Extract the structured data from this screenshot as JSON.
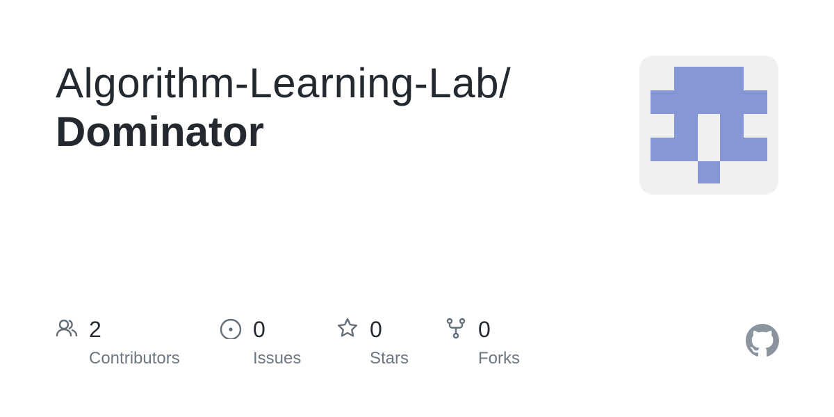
{
  "repo": {
    "owner": "Algorithm-Learning-Lab/",
    "name": "Dominator"
  },
  "avatar": {
    "background": "#f0f0f0",
    "fill": "#8796d6"
  },
  "stats": [
    {
      "icon": "people-icon",
      "count": "2",
      "label": "Contributors"
    },
    {
      "icon": "issue-opened-icon",
      "count": "0",
      "label": "Issues"
    },
    {
      "icon": "star-icon",
      "count": "0",
      "label": "Stars"
    },
    {
      "icon": "repo-forked-icon",
      "count": "0",
      "label": "Forks"
    }
  ],
  "colors": {
    "text": "#24292f",
    "muted": "#6e7781",
    "icon": "#656d76",
    "github_mark": "#8c959f"
  },
  "brand_icon": "github-mark-icon"
}
